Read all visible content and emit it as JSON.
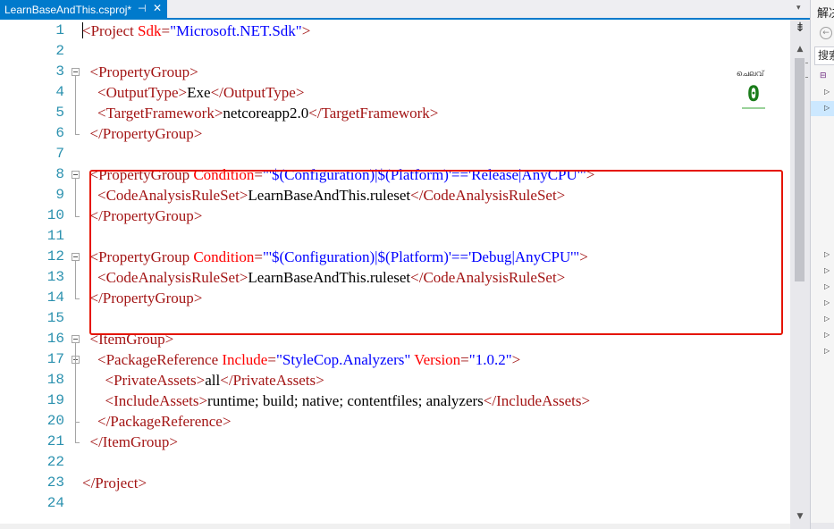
{
  "tab": {
    "title": "LearnBaseAndThis.csproj*",
    "pin_glyph": "⊣",
    "close_glyph": "✕",
    "overflow_glyph": "▾"
  },
  "editor": {
    "lines": [
      {
        "n": "1",
        "indent": "",
        "segs": [
          [
            "tag",
            "<Project "
          ],
          [
            "attr",
            "Sdk"
          ],
          [
            "tag",
            "="
          ],
          [
            "val",
            "\"Microsoft.NET.Sdk\""
          ],
          [
            "tag",
            ">"
          ]
        ]
      },
      {
        "n": "2",
        "indent": "",
        "segs": []
      },
      {
        "n": "3",
        "indent": "  ",
        "segs": [
          [
            "tag",
            "<PropertyGroup>"
          ]
        ]
      },
      {
        "n": "4",
        "indent": "    ",
        "segs": [
          [
            "tag",
            "<OutputType>"
          ],
          [
            "txt",
            "Exe"
          ],
          [
            "tag",
            "</OutputType>"
          ]
        ]
      },
      {
        "n": "5",
        "indent": "    ",
        "segs": [
          [
            "tag",
            "<TargetFramework>"
          ],
          [
            "txt",
            "netcoreapp2.0"
          ],
          [
            "tag",
            "</TargetFramework>"
          ]
        ]
      },
      {
        "n": "6",
        "indent": "  ",
        "segs": [
          [
            "tag",
            "</PropertyGroup>"
          ]
        ]
      },
      {
        "n": "7",
        "indent": "",
        "segs": []
      },
      {
        "n": "8",
        "indent": "  ",
        "segs": [
          [
            "tag",
            "<PropertyGroup "
          ],
          [
            "attr",
            "Condition"
          ],
          [
            "tag",
            "="
          ],
          [
            "val",
            "\"'$(Configuration)|$(Platform)'=='Release|AnyCPU'\""
          ],
          [
            "tag",
            ">"
          ]
        ]
      },
      {
        "n": "9",
        "indent": "    ",
        "segs": [
          [
            "tag",
            "<CodeAnalysisRuleSet>"
          ],
          [
            "txt",
            "LearnBaseAndThis.ruleset"
          ],
          [
            "tag",
            "</CodeAnalysisRuleSet>"
          ]
        ]
      },
      {
        "n": "10",
        "indent": "  ",
        "segs": [
          [
            "tag",
            "</PropertyGroup>"
          ]
        ]
      },
      {
        "n": "11",
        "indent": "",
        "segs": []
      },
      {
        "n": "12",
        "indent": "  ",
        "segs": [
          [
            "tag",
            "<PropertyGroup "
          ],
          [
            "attr",
            "Condition"
          ],
          [
            "tag",
            "="
          ],
          [
            "val",
            "\"'$(Configuration)|$(Platform)'=='Debug|AnyCPU'\""
          ],
          [
            "tag",
            ">"
          ]
        ]
      },
      {
        "n": "13",
        "indent": "    ",
        "segs": [
          [
            "tag",
            "<CodeAnalysisRuleSet>"
          ],
          [
            "txt",
            "LearnBaseAndThis.ruleset"
          ],
          [
            "tag",
            "</CodeAnalysisRuleSet>"
          ]
        ]
      },
      {
        "n": "14",
        "indent": "  ",
        "segs": [
          [
            "tag",
            "</PropertyGroup>"
          ]
        ]
      },
      {
        "n": "15",
        "indent": "",
        "segs": []
      },
      {
        "n": "16",
        "indent": "  ",
        "segs": [
          [
            "tag",
            "<ItemGroup>"
          ]
        ]
      },
      {
        "n": "17",
        "indent": "    ",
        "segs": [
          [
            "tag",
            "<PackageReference "
          ],
          [
            "attr",
            "Include"
          ],
          [
            "tag",
            "="
          ],
          [
            "val",
            "\"StyleCop.Analyzers\""
          ],
          [
            "attr",
            " Version"
          ],
          [
            "tag",
            "="
          ],
          [
            "val",
            "\"1.0.2\""
          ],
          [
            "tag",
            ">"
          ]
        ]
      },
      {
        "n": "18",
        "indent": "      ",
        "segs": [
          [
            "tag",
            "<PrivateAssets>"
          ],
          [
            "txt",
            "all"
          ],
          [
            "tag",
            "</PrivateAssets>"
          ]
        ]
      },
      {
        "n": "19",
        "indent": "      ",
        "segs": [
          [
            "tag",
            "<IncludeAssets>"
          ],
          [
            "txt",
            "runtime; build; native; contentfiles; analyzers"
          ],
          [
            "tag",
            "</IncludeAssets>"
          ]
        ]
      },
      {
        "n": "20",
        "indent": "    ",
        "segs": [
          [
            "tag",
            "</PackageReference>"
          ]
        ]
      },
      {
        "n": "21",
        "indent": "  ",
        "segs": [
          [
            "tag",
            "</ItemGroup>"
          ]
        ]
      },
      {
        "n": "22",
        "indent": "",
        "segs": []
      },
      {
        "n": "23",
        "indent": "",
        "segs": [
          [
            "tag",
            "</Project>"
          ]
        ]
      },
      {
        "n": "24",
        "indent": "",
        "segs": []
      }
    ],
    "fold_lines": [
      "3",
      "8",
      "12",
      "16",
      "17"
    ]
  },
  "counter": {
    "label": "ചെലവ്",
    "value": "0"
  },
  "scrollbar": {
    "split_glyph": "⇟",
    "up_glyph": "▲",
    "down_glyph": "▼"
  },
  "right_panel": {
    "title": "解决方案资源管理器",
    "back_glyph": "←",
    "search_text": "搜索",
    "project_icon": "⊟",
    "arrow_glyph": "▷",
    "colors": {
      "accent": "#007acc",
      "selection": "#cce8ff"
    }
  },
  "colors": {
    "tag": "#a31515",
    "attribute": "#ff0000",
    "value": "#0000ff",
    "line_number": "#2b91af",
    "highlight_box": "#e51400"
  }
}
